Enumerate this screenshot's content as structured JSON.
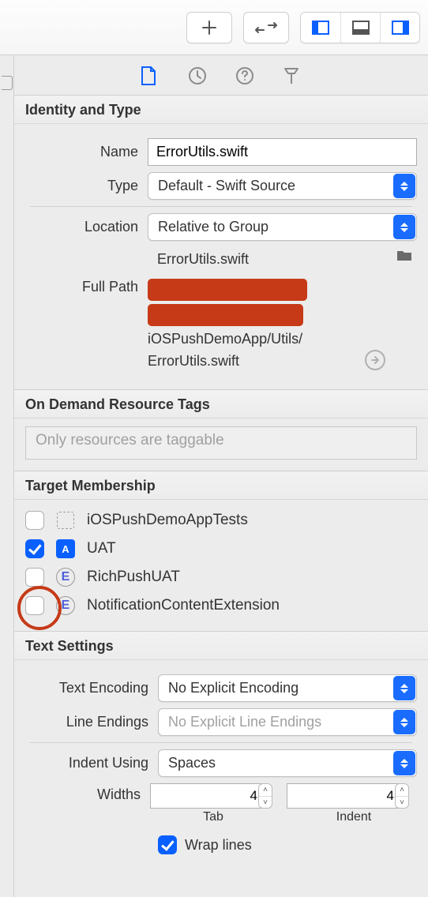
{
  "toolbar": {},
  "sections": {
    "identity": {
      "title": "Identity and Type",
      "name_label": "Name",
      "name_value": "ErrorUtils.swift",
      "type_label": "Type",
      "type_value": "Default - Swift Source",
      "location_label": "Location",
      "location_value": "Relative to Group",
      "location_file": "ErrorUtils.swift",
      "fullpath_label": "Full Path",
      "fullpath_line3": "iOSPushDemoApp/Utils/",
      "fullpath_line4": "ErrorUtils.swift"
    },
    "tags": {
      "title": "On Demand Resource Tags",
      "placeholder": "Only resources are taggable"
    },
    "membership": {
      "title": "Target Membership",
      "items": [
        {
          "label": "iOSPushDemoAppTests",
          "checked": false,
          "icon": "dashed"
        },
        {
          "label": "UAT",
          "checked": true,
          "icon": "app"
        },
        {
          "label": "RichPushUAT",
          "checked": false,
          "icon": "ext"
        },
        {
          "label": "NotificationContentExtension",
          "checked": false,
          "icon": "ext"
        }
      ]
    },
    "text": {
      "title": "Text Settings",
      "encoding_label": "Text Encoding",
      "encoding_value": "No Explicit Encoding",
      "endings_label": "Line Endings",
      "endings_value": "No Explicit Line Endings",
      "indent_label": "Indent Using",
      "indent_value": "Spaces",
      "widths_label": "Widths",
      "tab_value": "4",
      "tab_caption": "Tab",
      "indent_value_num": "4",
      "indent_caption": "Indent",
      "wrap_label": "Wrap lines",
      "wrap_checked": true
    }
  }
}
